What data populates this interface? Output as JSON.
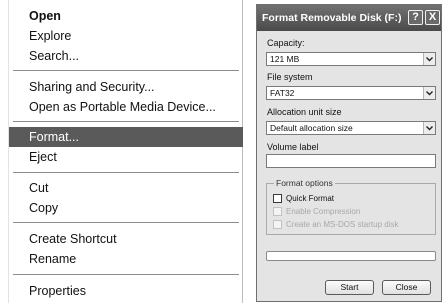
{
  "context_menu": {
    "items": [
      {
        "label": "Open"
      },
      {
        "label": "Explore"
      },
      {
        "label": "Search..."
      },
      {
        "label": "Sharing and Security..."
      },
      {
        "label": "Open as Portable Media Device..."
      },
      {
        "label": "Format..."
      },
      {
        "label": "Eject"
      },
      {
        "label": "Cut"
      },
      {
        "label": "Copy"
      },
      {
        "label": "Create Shortcut"
      },
      {
        "label": "Rename"
      },
      {
        "label": "Properties"
      }
    ],
    "selected": "Format..."
  },
  "dialog": {
    "title": "Format Removable Disk (F:)",
    "help_button": "?",
    "close_button": "X",
    "capacity": {
      "label": "Capacity:",
      "value": "121 MB"
    },
    "file_system": {
      "label": "File system",
      "value": "FAT32"
    },
    "allocation": {
      "label": "Allocation unit size",
      "value": "Default allocation size"
    },
    "volume_label": {
      "label": "Volume label",
      "value": ""
    },
    "format_options": {
      "legend": "Format options",
      "quick_format": {
        "label": "Quick Format",
        "checked": false,
        "enabled": true
      },
      "enable_compression": {
        "label": "Enable Compression",
        "checked": false,
        "enabled": false
      },
      "msdos_startup": {
        "label": "Create an MS-DOS startup disk",
        "checked": false,
        "enabled": false
      }
    },
    "progress": 0,
    "start_label": "Start",
    "close_label": "Close"
  }
}
